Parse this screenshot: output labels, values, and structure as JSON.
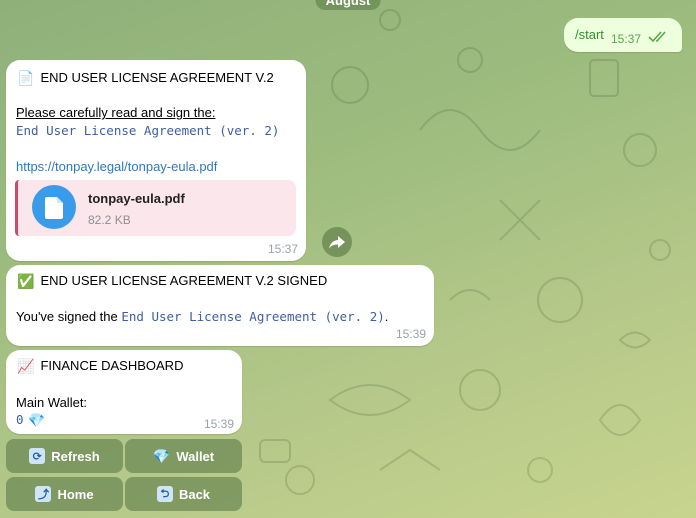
{
  "date_chip": "August",
  "outgoing": {
    "text": "/start",
    "time": "15:37"
  },
  "messages": {
    "eula": {
      "icon": "page-facing-up",
      "title": "END USER LICENSE AGREEMENT V.2",
      "instruction": "Please carefully read and sign the:",
      "agreement_name": "End User License Agreement (ver. 2)",
      "link": "https://tonpay.legal/tonpay-eula.pdf",
      "file": {
        "name": "tonpay-eula.pdf",
        "size": "82.2 KB"
      },
      "time": "15:37"
    },
    "signed": {
      "icon": "check-mark-button",
      "title": "END USER LICENSE AGREEMENT V.2 SIGNED",
      "prefix": "You've signed the ",
      "agreement_name": "End User License Agreement (ver. 2)",
      "suffix": ".",
      "time": "15:39"
    },
    "dashboard": {
      "icon": "chart-increasing",
      "title": "FINANCE DASHBOARD",
      "label": "Main Wallet:",
      "balance": "0",
      "balance_icon": "gem-stone",
      "time": "15:39"
    }
  },
  "keyboard": {
    "refresh": "Refresh",
    "wallet": "Wallet",
    "home": "Home",
    "back": "Back"
  },
  "colors": {
    "link": "#2e79c1",
    "mono": "#3d5fa0",
    "file_accent": "#d2486d",
    "file_icon": "#3a9be8",
    "outgoing_bg": "#eeffde"
  }
}
